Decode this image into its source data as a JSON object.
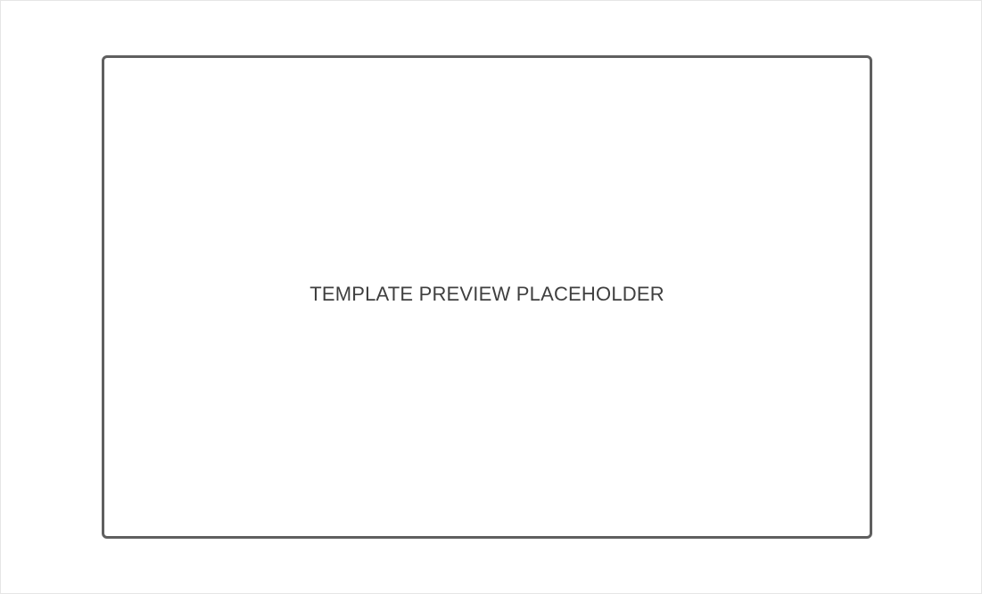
{
  "preview": {
    "placeholder_text": "TEMPLATE PREVIEW PLACEHOLDER"
  },
  "colors": {
    "border": "#5f5f5f",
    "text": "#3f3f3f",
    "background": "#ffffff",
    "outer_frame": "#e6e6e6"
  }
}
